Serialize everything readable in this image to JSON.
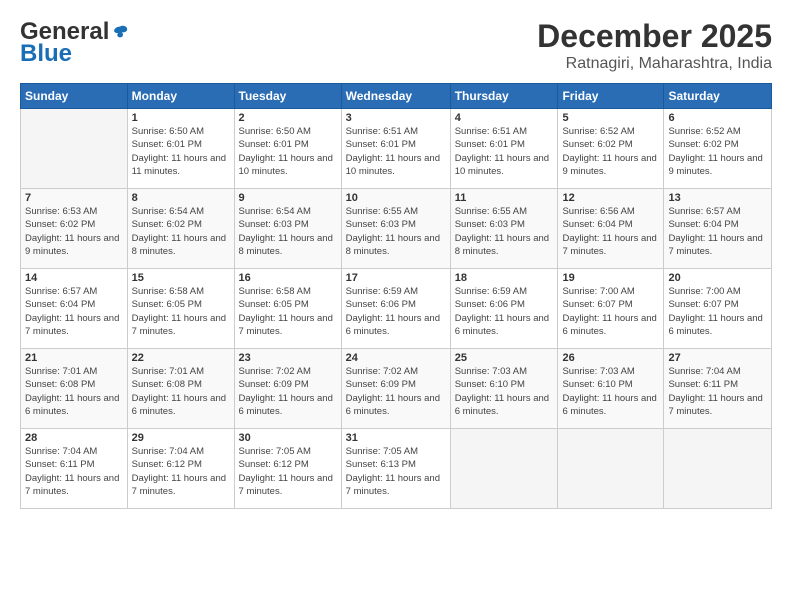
{
  "logo": {
    "general": "General",
    "blue": "Blue"
  },
  "title": "December 2025",
  "subtitle": "Ratnagiri, Maharashtra, India",
  "days_header": [
    "Sunday",
    "Monday",
    "Tuesday",
    "Wednesday",
    "Thursday",
    "Friday",
    "Saturday"
  ],
  "weeks": [
    [
      {
        "day": "",
        "sunrise": "",
        "sunset": "",
        "daylight": ""
      },
      {
        "day": "1",
        "sunrise": "Sunrise: 6:50 AM",
        "sunset": "Sunset: 6:01 PM",
        "daylight": "Daylight: 11 hours and 11 minutes."
      },
      {
        "day": "2",
        "sunrise": "Sunrise: 6:50 AM",
        "sunset": "Sunset: 6:01 PM",
        "daylight": "Daylight: 11 hours and 10 minutes."
      },
      {
        "day": "3",
        "sunrise": "Sunrise: 6:51 AM",
        "sunset": "Sunset: 6:01 PM",
        "daylight": "Daylight: 11 hours and 10 minutes."
      },
      {
        "day": "4",
        "sunrise": "Sunrise: 6:51 AM",
        "sunset": "Sunset: 6:01 PM",
        "daylight": "Daylight: 11 hours and 10 minutes."
      },
      {
        "day": "5",
        "sunrise": "Sunrise: 6:52 AM",
        "sunset": "Sunset: 6:02 PM",
        "daylight": "Daylight: 11 hours and 9 minutes."
      },
      {
        "day": "6",
        "sunrise": "Sunrise: 6:52 AM",
        "sunset": "Sunset: 6:02 PM",
        "daylight": "Daylight: 11 hours and 9 minutes."
      }
    ],
    [
      {
        "day": "7",
        "sunrise": "Sunrise: 6:53 AM",
        "sunset": "Sunset: 6:02 PM",
        "daylight": "Daylight: 11 hours and 9 minutes."
      },
      {
        "day": "8",
        "sunrise": "Sunrise: 6:54 AM",
        "sunset": "Sunset: 6:02 PM",
        "daylight": "Daylight: 11 hours and 8 minutes."
      },
      {
        "day": "9",
        "sunrise": "Sunrise: 6:54 AM",
        "sunset": "Sunset: 6:03 PM",
        "daylight": "Daylight: 11 hours and 8 minutes."
      },
      {
        "day": "10",
        "sunrise": "Sunrise: 6:55 AM",
        "sunset": "Sunset: 6:03 PM",
        "daylight": "Daylight: 11 hours and 8 minutes."
      },
      {
        "day": "11",
        "sunrise": "Sunrise: 6:55 AM",
        "sunset": "Sunset: 6:03 PM",
        "daylight": "Daylight: 11 hours and 8 minutes."
      },
      {
        "day": "12",
        "sunrise": "Sunrise: 6:56 AM",
        "sunset": "Sunset: 6:04 PM",
        "daylight": "Daylight: 11 hours and 7 minutes."
      },
      {
        "day": "13",
        "sunrise": "Sunrise: 6:57 AM",
        "sunset": "Sunset: 6:04 PM",
        "daylight": "Daylight: 11 hours and 7 minutes."
      }
    ],
    [
      {
        "day": "14",
        "sunrise": "Sunrise: 6:57 AM",
        "sunset": "Sunset: 6:04 PM",
        "daylight": "Daylight: 11 hours and 7 minutes."
      },
      {
        "day": "15",
        "sunrise": "Sunrise: 6:58 AM",
        "sunset": "Sunset: 6:05 PM",
        "daylight": "Daylight: 11 hours and 7 minutes."
      },
      {
        "day": "16",
        "sunrise": "Sunrise: 6:58 AM",
        "sunset": "Sunset: 6:05 PM",
        "daylight": "Daylight: 11 hours and 7 minutes."
      },
      {
        "day": "17",
        "sunrise": "Sunrise: 6:59 AM",
        "sunset": "Sunset: 6:06 PM",
        "daylight": "Daylight: 11 hours and 6 minutes."
      },
      {
        "day": "18",
        "sunrise": "Sunrise: 6:59 AM",
        "sunset": "Sunset: 6:06 PM",
        "daylight": "Daylight: 11 hours and 6 minutes."
      },
      {
        "day": "19",
        "sunrise": "Sunrise: 7:00 AM",
        "sunset": "Sunset: 6:07 PM",
        "daylight": "Daylight: 11 hours and 6 minutes."
      },
      {
        "day": "20",
        "sunrise": "Sunrise: 7:00 AM",
        "sunset": "Sunset: 6:07 PM",
        "daylight": "Daylight: 11 hours and 6 minutes."
      }
    ],
    [
      {
        "day": "21",
        "sunrise": "Sunrise: 7:01 AM",
        "sunset": "Sunset: 6:08 PM",
        "daylight": "Daylight: 11 hours and 6 minutes."
      },
      {
        "day": "22",
        "sunrise": "Sunrise: 7:01 AM",
        "sunset": "Sunset: 6:08 PM",
        "daylight": "Daylight: 11 hours and 6 minutes."
      },
      {
        "day": "23",
        "sunrise": "Sunrise: 7:02 AM",
        "sunset": "Sunset: 6:09 PM",
        "daylight": "Daylight: 11 hours and 6 minutes."
      },
      {
        "day": "24",
        "sunrise": "Sunrise: 7:02 AM",
        "sunset": "Sunset: 6:09 PM",
        "daylight": "Daylight: 11 hours and 6 minutes."
      },
      {
        "day": "25",
        "sunrise": "Sunrise: 7:03 AM",
        "sunset": "Sunset: 6:10 PM",
        "daylight": "Daylight: 11 hours and 6 minutes."
      },
      {
        "day": "26",
        "sunrise": "Sunrise: 7:03 AM",
        "sunset": "Sunset: 6:10 PM",
        "daylight": "Daylight: 11 hours and 6 minutes."
      },
      {
        "day": "27",
        "sunrise": "Sunrise: 7:04 AM",
        "sunset": "Sunset: 6:11 PM",
        "daylight": "Daylight: 11 hours and 7 minutes."
      }
    ],
    [
      {
        "day": "28",
        "sunrise": "Sunrise: 7:04 AM",
        "sunset": "Sunset: 6:11 PM",
        "daylight": "Daylight: 11 hours and 7 minutes."
      },
      {
        "day": "29",
        "sunrise": "Sunrise: 7:04 AM",
        "sunset": "Sunset: 6:12 PM",
        "daylight": "Daylight: 11 hours and 7 minutes."
      },
      {
        "day": "30",
        "sunrise": "Sunrise: 7:05 AM",
        "sunset": "Sunset: 6:12 PM",
        "daylight": "Daylight: 11 hours and 7 minutes."
      },
      {
        "day": "31",
        "sunrise": "Sunrise: 7:05 AM",
        "sunset": "Sunset: 6:13 PM",
        "daylight": "Daylight: 11 hours and 7 minutes."
      },
      {
        "day": "",
        "sunrise": "",
        "sunset": "",
        "daylight": ""
      },
      {
        "day": "",
        "sunrise": "",
        "sunset": "",
        "daylight": ""
      },
      {
        "day": "",
        "sunrise": "",
        "sunset": "",
        "daylight": ""
      }
    ]
  ]
}
